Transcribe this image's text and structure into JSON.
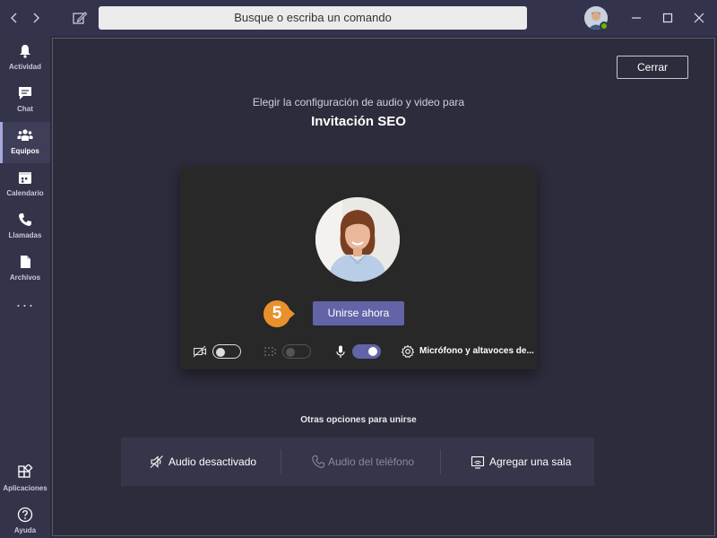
{
  "titlebar": {
    "search_placeholder": "Busque o escriba un comando"
  },
  "rail": {
    "items": [
      {
        "label": "Actividad",
        "icon": "bell-icon"
      },
      {
        "label": "Chat",
        "icon": "chat-icon"
      },
      {
        "label": "Equipos",
        "icon": "teams-icon"
      },
      {
        "label": "Calendario",
        "icon": "calendar-icon"
      },
      {
        "label": "Llamadas",
        "icon": "phone-icon"
      },
      {
        "label": "Archivos",
        "icon": "file-icon"
      }
    ],
    "more": "···",
    "bottom": [
      {
        "label": "Aplicaciones",
        "icon": "apps-icon"
      },
      {
        "label": "Ayuda",
        "icon": "help-icon"
      }
    ],
    "active_index": 2
  },
  "stage": {
    "close_label": "Cerrar",
    "subtitle": "Elegir la configuración de audio y video para",
    "meeting_title": "Invitación SEO"
  },
  "preview": {
    "join_label": "Unirse ahora",
    "step_number": "5",
    "device_label": "Micrófono y altavoces de...",
    "video_on": false,
    "blur_on": false,
    "mic_on": true
  },
  "other_options": {
    "title": "Otras opciones para unirse",
    "items": [
      {
        "label": "Audio desactivado",
        "icon": "speaker-off-icon",
        "enabled": true
      },
      {
        "label": "Audio del teléfono",
        "icon": "phone-icon",
        "enabled": false
      },
      {
        "label": "Agregar una sala",
        "icon": "cast-icon",
        "enabled": true
      }
    ]
  },
  "colors": {
    "accent": "#6264a7",
    "badge": "#e8912c",
    "presence": "#6bb700"
  }
}
